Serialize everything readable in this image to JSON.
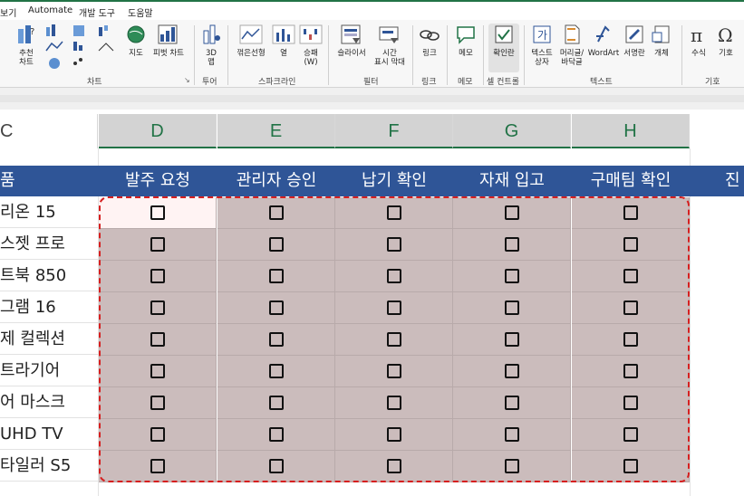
{
  "menu_tabs": [
    "보기",
    "Automate",
    "개발 도구",
    "도움말"
  ],
  "ribbon": {
    "chart_group": {
      "recommended_label": "추천\n차트",
      "map_label": "지도",
      "pivot_label": "피벗 차트",
      "group_label": "차트"
    },
    "tour_group": {
      "map3d_label": "3D\n맵",
      "group_label": "투어"
    },
    "sparkline_group": {
      "line_label": "꺾은선형",
      "column_label": "열",
      "winloss_label": "승패\n(W)",
      "group_label": "스파크라인"
    },
    "filter_group": {
      "slicer_label": "슬라이서",
      "timeline_label": "시간\n표시 막대",
      "group_label": "필터"
    },
    "link_group": {
      "link_label": "링크",
      "group_label": "링크"
    },
    "memo_group": {
      "memo_label": "메모",
      "group_label": "메모"
    },
    "cell_control_group": {
      "checkbox_label": "확인란",
      "group_label": "셀 컨트롤"
    },
    "text_group": {
      "textbox_label": "텍스트\n상자",
      "headerfooter_label": "머리글/\n바닥글",
      "wordart_label": "WordArt",
      "signature_label": "서명란",
      "object_label": "개체",
      "group_label": "텍스트"
    },
    "symbol_group": {
      "equation_label": "수식",
      "symbol_label": "기호",
      "group_label": "기호"
    }
  },
  "columns": [
    "C",
    "D",
    "E",
    "F",
    "G",
    "H"
  ],
  "table": {
    "headers": [
      "품",
      "발주 요청",
      "관리자 승인",
      "납기 확인",
      "자재 입고",
      "구매팀 확인",
      "진"
    ],
    "products": [
      "리온 15",
      "스젯 프로",
      "트북 850",
      "그램 16",
      "제 컬렉션",
      "트라기어",
      "어 마스크",
      " UHD TV",
      "타일러 S5"
    ],
    "checkbox_rows": 9,
    "checkbox_cols": 5
  },
  "colors": {
    "header_blue": "#2f5597",
    "cell_fill": "#cbbcbc",
    "selection_border": "#d61f1f",
    "excel_green": "#217346"
  }
}
